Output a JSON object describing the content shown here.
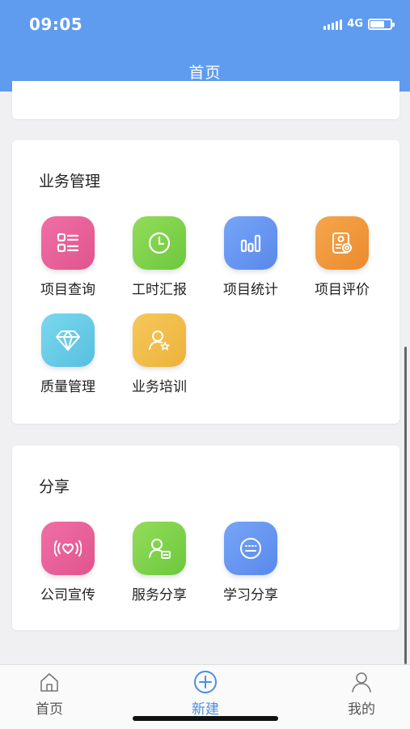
{
  "status": {
    "time": "09:05",
    "network": "4G"
  },
  "header": {
    "title": "首页"
  },
  "business": {
    "title": "业务管理",
    "items": [
      {
        "label": "项目查询",
        "icon": "list-grid-icon",
        "color": "#e85c98"
      },
      {
        "label": "工时汇报",
        "icon": "clock-icon",
        "color": "#7fd24a"
      },
      {
        "label": "项目统计",
        "icon": "bar-chart-icon",
        "color": "#6795f0"
      },
      {
        "label": "项目评价",
        "icon": "document-badge-icon",
        "color": "#f09a3c"
      },
      {
        "label": "质量管理",
        "icon": "diamond-icon",
        "color": "#66cbe8"
      },
      {
        "label": "业务培训",
        "icon": "user-star-icon",
        "color": "#f0bd4b"
      }
    ]
  },
  "share": {
    "title": "分享",
    "items": [
      {
        "label": "公司宣传",
        "icon": "broadcast-heart-icon",
        "color": "#e85c98"
      },
      {
        "label": "服务分享",
        "icon": "user-card-icon",
        "color": "#7fd24a"
      },
      {
        "label": "学习分享",
        "icon": "keyboard-bubble-icon",
        "color": "#6795f0"
      }
    ]
  },
  "tabbar": {
    "home": "首页",
    "new": "新建",
    "mine": "我的",
    "active_color": "#4a90e2"
  }
}
